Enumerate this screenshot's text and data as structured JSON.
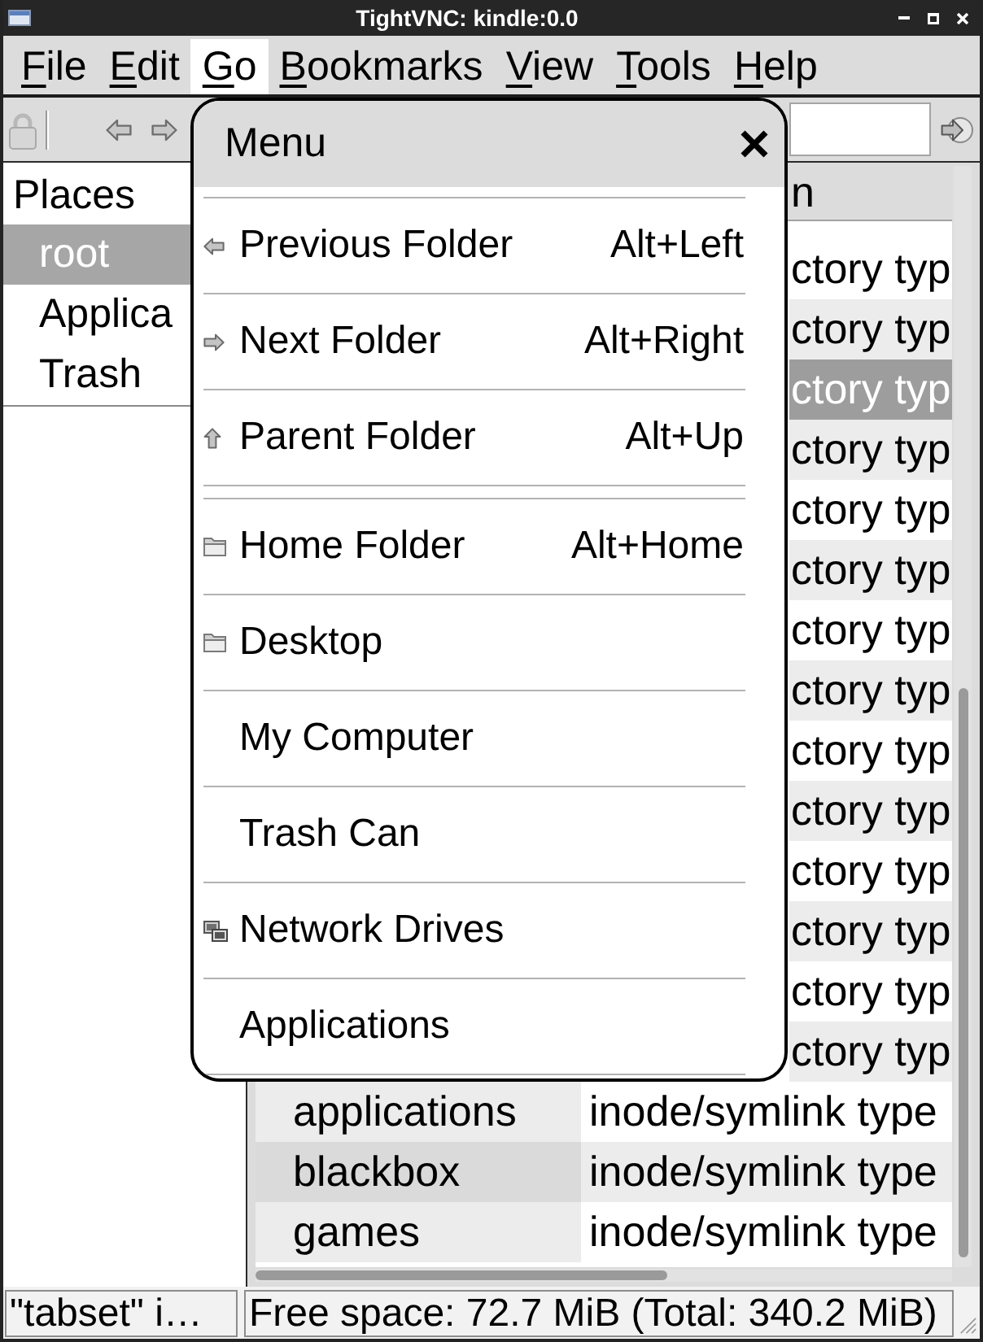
{
  "window": {
    "title": "TightVNC: kindle:0.0"
  },
  "menu_bar": [
    {
      "label": "File",
      "selected": false
    },
    {
      "label": "Edit",
      "selected": false
    },
    {
      "label": "Go",
      "selected": true
    },
    {
      "label": "Bookmarks",
      "selected": false
    },
    {
      "label": "View",
      "selected": false
    },
    {
      "label": "Tools",
      "selected": false
    },
    {
      "label": "Help",
      "selected": false
    }
  ],
  "places": {
    "title": "Places",
    "items": [
      {
        "label": "root",
        "selected": true
      },
      {
        "label": "Applica",
        "selected": false
      },
      {
        "label": "Trash",
        "selected": false
      }
    ]
  },
  "file_list": {
    "header": {
      "column_2": "n"
    },
    "rows": [
      {
        "column_2": "ctory typ",
        "selected": false
      },
      {
        "column_2": "ctory typ",
        "selected": false
      },
      {
        "column_2": "ctory typ",
        "selected": true
      },
      {
        "column_2": "ctory typ",
        "selected": false
      },
      {
        "column_2": "ctory typ",
        "selected": false
      },
      {
        "column_2": "ctory typ",
        "selected": false
      },
      {
        "column_2": "ctory typ",
        "selected": false
      },
      {
        "column_2": "ctory typ",
        "selected": false
      },
      {
        "column_2": "ctory typ",
        "selected": false
      },
      {
        "column_2": "ctory typ",
        "selected": false
      },
      {
        "column_2": "ctory typ",
        "selected": false
      },
      {
        "column_2": "ctory typ",
        "selected": false
      },
      {
        "column_2": "ctory typ",
        "selected": false
      },
      {
        "column_2": "ctory typ",
        "selected": false
      },
      {
        "column_1": "applications",
        "column_2": "inode/symlink type",
        "selected": false
      },
      {
        "column_1": "blackbox",
        "column_2": "inode/symlink type",
        "selected": false
      },
      {
        "column_1": "games",
        "column_2": "inode/symlink type",
        "selected": false
      }
    ]
  },
  "go_menu": {
    "title": "Menu",
    "sections": [
      {
        "items": [
          {
            "kind": "back",
            "label": "Previous Folder",
            "shortcut": "Alt+Left"
          },
          {
            "kind": "forward",
            "label": "Next Folder",
            "shortcut": "Alt+Right"
          },
          {
            "kind": "up",
            "label": "Parent Folder",
            "shortcut": "Alt+Up"
          }
        ]
      },
      {
        "items": [
          {
            "kind": "folder",
            "label": "Home Folder",
            "shortcut": "Alt+Home"
          },
          {
            "kind": "folder",
            "label": "Desktop"
          },
          {
            "kind": "plain",
            "label": "My Computer"
          },
          {
            "kind": "plain",
            "label": "Trash Can"
          },
          {
            "kind": "network",
            "label": "Network Drives"
          },
          {
            "kind": "plain",
            "label": "Applications"
          }
        ]
      }
    ]
  },
  "status_bar": [
    {
      "text": "\"tabset\" i…"
    },
    {
      "text": "Free space: 72.7 MiB (Total: 340.2 MiB)"
    }
  ]
}
